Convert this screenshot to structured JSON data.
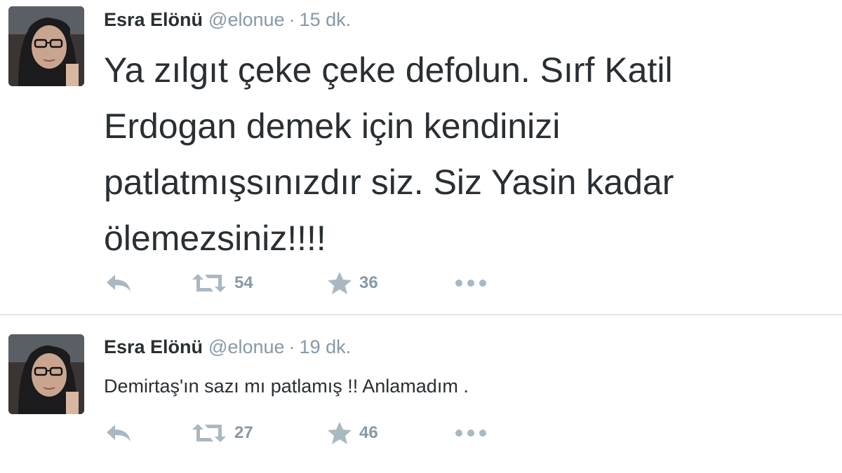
{
  "tweets": [
    {
      "author": {
        "name": "Esra Elönü",
        "handle": "@elonue"
      },
      "separator": "·",
      "time": "15 dk.",
      "text_lines": [
        "Ya zılgıt çeke çeke defolun. Sırf Katil",
        "Erdogan demek için kendinizi",
        "patlatmışsınızdır siz. Siz Yasin kadar",
        "ölemezsiniz!!!!"
      ],
      "retweets": "54",
      "favorites": "36"
    },
    {
      "author": {
        "name": "Esra Elönü",
        "handle": "@elonue"
      },
      "separator": "·",
      "time": "19 dk.",
      "text_lines": [
        "Demirtaş'ın sazı mı patlamış !! Anlamadım ."
      ],
      "retweets": "27",
      "favorites": "46"
    }
  ],
  "icons": {
    "reply": "reply-icon",
    "retweet": "retweet-icon",
    "favorite": "star-icon",
    "more": "more-icon"
  },
  "colors": {
    "text": "#292f33",
    "muted": "#8899a6",
    "icon": "#aab8c2",
    "divider": "#e1e8ed"
  }
}
